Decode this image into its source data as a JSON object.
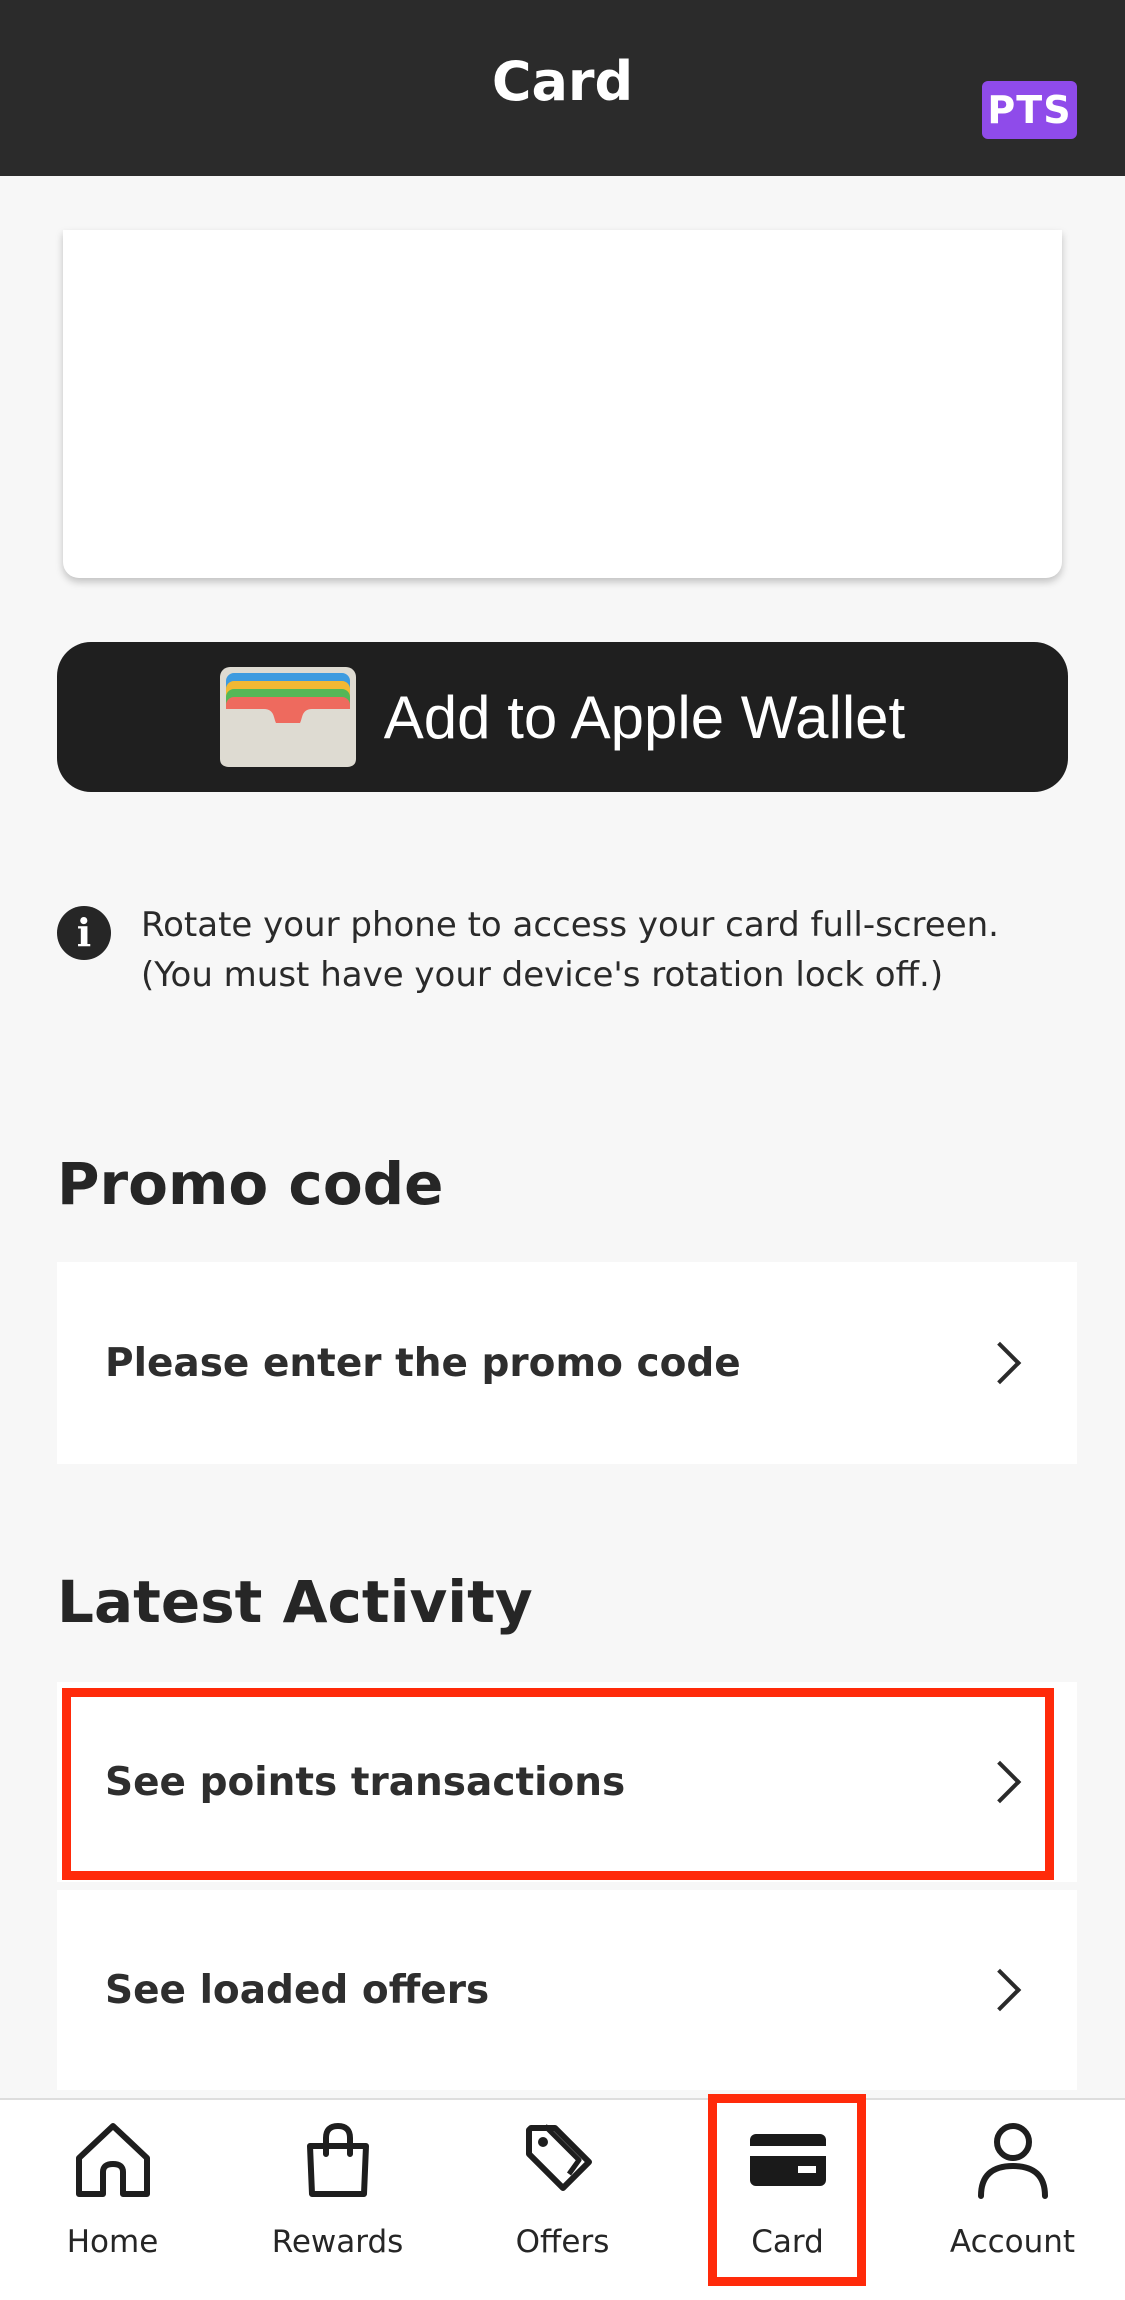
{
  "header": {
    "title": "Card",
    "badge": "PTS",
    "badge_color": "#8f4bea"
  },
  "wallet": {
    "label": "Add to Apple Wallet"
  },
  "info": {
    "icon": "info-icon",
    "line1": "Rotate your phone to access your card full-screen.",
    "line2": "(You must have your device's rotation lock off.)"
  },
  "promo": {
    "title": "Promo code",
    "row_label": "Please enter the promo code"
  },
  "activity": {
    "title": "Latest Activity",
    "rows": [
      {
        "label": "See points transactions"
      },
      {
        "label": "See loaded offers"
      }
    ]
  },
  "tabs": [
    {
      "label": "Home",
      "icon": "home-icon"
    },
    {
      "label": "Rewards",
      "icon": "shopping-bag-icon"
    },
    {
      "label": "Offers",
      "icon": "tag-icon"
    },
    {
      "label": "Card",
      "icon": "card-icon"
    },
    {
      "label": "Account",
      "icon": "person-icon"
    }
  ],
  "colors": {
    "highlight": "#ff2a0a",
    "header_bg": "#2b2b2b"
  }
}
